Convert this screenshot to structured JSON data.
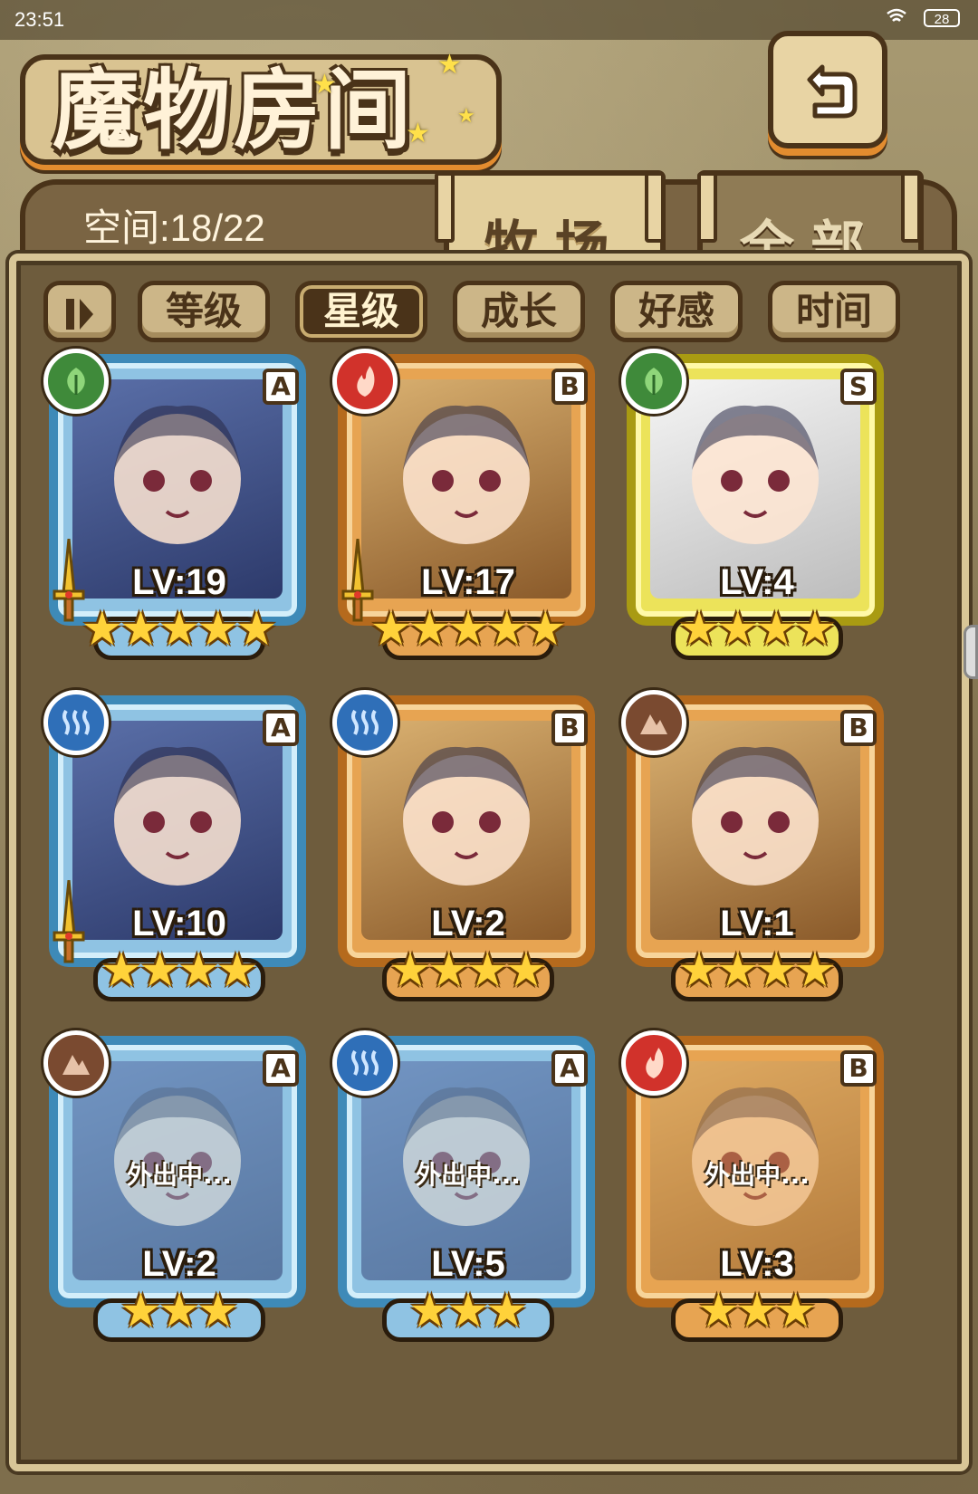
{
  "status_bar": {
    "time": "23:51",
    "battery": "28"
  },
  "header": {
    "title": "魔物房间",
    "space_label": "空间:18/22"
  },
  "tabs": [
    {
      "label": "牧场",
      "active": true
    },
    {
      "label": "全部",
      "active": false
    }
  ],
  "sort": {
    "buttons": [
      {
        "label": "等级",
        "active": false
      },
      {
        "label": "星级",
        "active": true
      },
      {
        "label": "成长",
        "active": false
      },
      {
        "label": "好感",
        "active": false
      },
      {
        "label": "时间",
        "active": false
      }
    ]
  },
  "monsters": [
    {
      "level": "LV:19",
      "rank": "A",
      "element": "grass",
      "frame": "blue",
      "stars": 5,
      "away": ""
    },
    {
      "level": "LV:17",
      "rank": "B",
      "element": "fire",
      "frame": "gold",
      "stars": 5,
      "away": ""
    },
    {
      "level": "LV:4",
      "rank": "S",
      "element": "grass",
      "frame": "yellow",
      "stars": 4,
      "away": ""
    },
    {
      "level": "LV:10",
      "rank": "A",
      "element": "water",
      "frame": "blue",
      "stars": 4,
      "away": ""
    },
    {
      "level": "LV:2",
      "rank": "B",
      "element": "water",
      "frame": "gold",
      "stars": 4,
      "away": ""
    },
    {
      "level": "LV:1",
      "rank": "B",
      "element": "earth",
      "frame": "gold",
      "stars": 4,
      "away": ""
    },
    {
      "level": "LV:2",
      "rank": "A",
      "element": "earth",
      "frame": "blue",
      "stars": 3,
      "away": "外出中..."
    },
    {
      "level": "LV:5",
      "rank": "A",
      "element": "water",
      "frame": "blue",
      "stars": 3,
      "away": "外出中..."
    },
    {
      "level": "LV:3",
      "rank": "B",
      "element": "fire",
      "frame": "gold",
      "stars": 3,
      "away": "外出中..."
    }
  ],
  "colors": {
    "frame_blue": "#3e8ab8",
    "frame_gold": "#b56a1d",
    "frame_yellow": "#a99b12",
    "star": "#ffd23a"
  }
}
